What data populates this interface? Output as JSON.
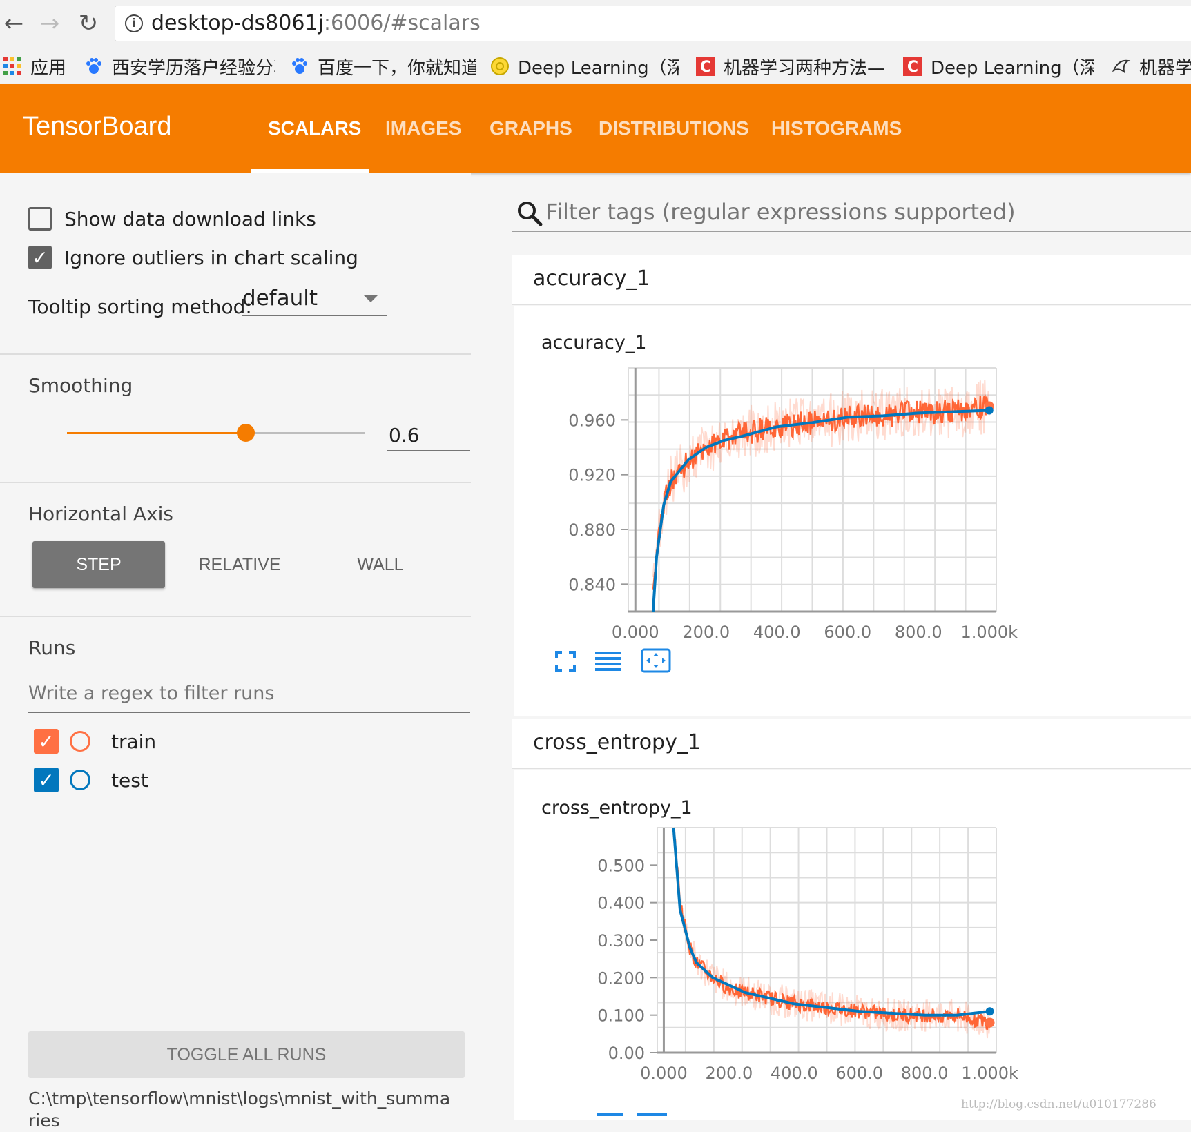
{
  "browser": {
    "url_host": "desktop-ds8061j",
    "url_rest": ":6006/#scalars",
    "bookmarks": [
      {
        "label": "应用",
        "icon": "apps-grid-icon"
      },
      {
        "label": "西安学历落户经验分享",
        "icon": "baidu-paw-icon"
      },
      {
        "label": "百度一下，你就知道",
        "icon": "baidu-paw-icon"
      },
      {
        "label": "Deep Learning（深度",
        "icon": "yellow-globe-icon"
      },
      {
        "label": "机器学习两种方法——",
        "icon": "csdn-c-icon"
      },
      {
        "label": "Deep Learning（深度",
        "icon": "csdn-c-icon"
      },
      {
        "label": "机器学",
        "icon": "bird-icon"
      }
    ]
  },
  "header": {
    "logo": "TensorBoard",
    "tabs": [
      "SCALARS",
      "IMAGES",
      "GRAPHS",
      "DISTRIBUTIONS",
      "HISTOGRAMS"
    ],
    "active_tab": "SCALARS"
  },
  "sidebar": {
    "show_download_links": {
      "label": "Show data download links",
      "checked": false
    },
    "ignore_outliers": {
      "label": "Ignore outliers in chart scaling",
      "checked": true
    },
    "tooltip_sorting": {
      "label": "Tooltip sorting method:",
      "value": "default"
    },
    "smoothing": {
      "label": "Smoothing",
      "value": "0.6",
      "fraction": 0.6
    },
    "horizontal_axis": {
      "label": "Horizontal Axis",
      "options": [
        "STEP",
        "RELATIVE",
        "WALL"
      ],
      "selected": "STEP"
    },
    "runs": {
      "label": "Runs",
      "filter_placeholder": "Write a regex to filter runs",
      "items": [
        {
          "name": "train",
          "color": "#ff7043",
          "checked": true
        },
        {
          "name": "test",
          "color": "#0277bd",
          "checked": true
        }
      ]
    },
    "toggle_all": "TOGGLE ALL RUNS",
    "logdir": "C:\\tmp\\tensorflow\\mnist\\logs\\mnist_with_summaries"
  },
  "main": {
    "filter_placeholder": "Filter tags (regular expressions supported)",
    "cards": [
      {
        "header": "accuracy_1",
        "chart_title": "accuracy_1"
      },
      {
        "header": "cross_entropy_1",
        "chart_title": "cross_entropy_1"
      }
    ]
  },
  "colors": {
    "accent": "#f57c00",
    "train": "#ff7043",
    "test": "#0277bd"
  },
  "watermark": "http://blog.csdn.net/u010177286",
  "chart_data": [
    {
      "type": "line",
      "title": "accuracy_1",
      "x_ticks": [
        "0.000",
        "200.0",
        "400.0",
        "600.0",
        "800.0",
        "1.000k"
      ],
      "y_ticks": [
        "0.840",
        "0.880",
        "0.920",
        "0.960"
      ],
      "xlim": [
        -20,
        1020
      ],
      "ylim": [
        0.82,
        0.998
      ],
      "grid": true,
      "series": [
        {
          "name": "train",
          "x": [
            50,
            60,
            80,
            100,
            150,
            200,
            250,
            300,
            400,
            500,
            600,
            700,
            800,
            900,
            1000
          ],
          "y": [
            0.83,
            0.86,
            0.9,
            0.915,
            0.93,
            0.94,
            0.945,
            0.95,
            0.955,
            0.958,
            0.962,
            0.963,
            0.966,
            0.966,
            0.97
          ]
        },
        {
          "name": "test",
          "x": [
            50,
            60,
            80,
            100,
            150,
            200,
            250,
            300,
            400,
            500,
            600,
            700,
            800,
            900,
            1000
          ],
          "y": [
            0.82,
            0.86,
            0.898,
            0.915,
            0.931,
            0.94,
            0.945,
            0.948,
            0.955,
            0.958,
            0.962,
            0.963,
            0.965,
            0.966,
            0.967
          ]
        }
      ]
    },
    {
      "type": "line",
      "title": "cross_entropy_1",
      "x_ticks": [
        "0.000",
        "200.0",
        "400.0",
        "600.0",
        "800.0",
        "1.000k"
      ],
      "y_ticks": [
        "0.00",
        "0.100",
        "0.200",
        "0.300",
        "0.400",
        "0.500"
      ],
      "xlim": [
        -20,
        1020
      ],
      "ylim": [
        0,
        0.6
      ],
      "grid": true,
      "series": [
        {
          "name": "train",
          "x": [
            30,
            50,
            80,
            100,
            150,
            200,
            250,
            300,
            400,
            500,
            600,
            700,
            800,
            900,
            1000
          ],
          "y": [
            0.6,
            0.4,
            0.28,
            0.24,
            0.2,
            0.17,
            0.16,
            0.15,
            0.13,
            0.12,
            0.11,
            0.1,
            0.1,
            0.1,
            0.08
          ]
        },
        {
          "name": "test",
          "x": [
            30,
            50,
            80,
            100,
            150,
            200,
            250,
            300,
            400,
            500,
            600,
            700,
            800,
            900,
            1000
          ],
          "y": [
            0.6,
            0.38,
            0.28,
            0.24,
            0.2,
            0.18,
            0.16,
            0.15,
            0.13,
            0.12,
            0.11,
            0.105,
            0.1,
            0.1,
            0.11
          ]
        }
      ]
    }
  ]
}
